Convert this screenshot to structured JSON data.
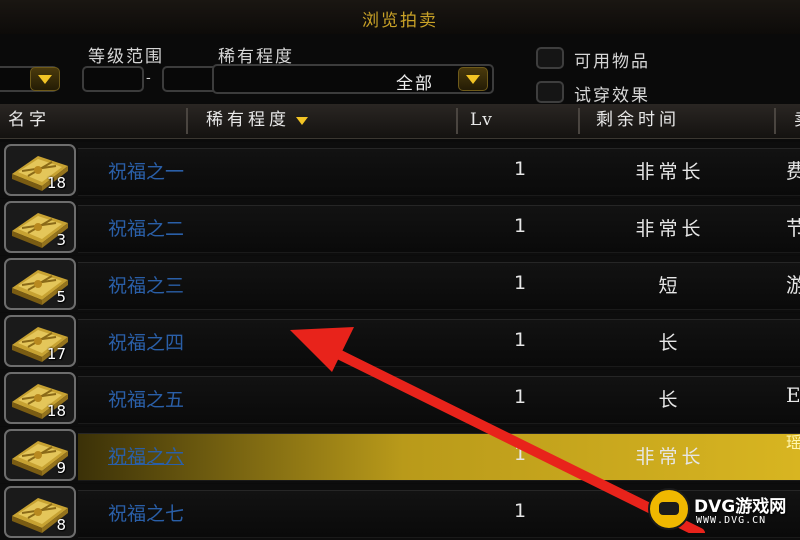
{
  "window": {
    "title": "浏览拍卖"
  },
  "filters": {
    "level_range_label": "等级范围",
    "level_separator": "-",
    "rarity_label": "稀有程度",
    "rarity_value": "全部",
    "usable_items_label": "可用物品",
    "try_on_label": "试穿效果"
  },
  "columns": {
    "name": "名字",
    "rarity": "稀有程度",
    "lv": "Lv",
    "time_left": "剩余时间",
    "seller": "卖"
  },
  "rows": [
    {
      "name": "祝福之一",
      "count": "18",
      "lv": "1",
      "time_left": "非常长",
      "seller": "费"
    },
    {
      "name": "祝福之二",
      "count": "3",
      "lv": "1",
      "time_left": "非常长",
      "seller": "节"
    },
    {
      "name": "祝福之三",
      "count": "5",
      "lv": "1",
      "time_left": "短",
      "seller": "游"
    },
    {
      "name": "祝福之四",
      "count": "17",
      "lv": "1",
      "time_left": "长",
      "seller": ""
    },
    {
      "name": "祝福之五",
      "count": "18",
      "lv": "1",
      "time_left": "长",
      "seller": "E"
    },
    {
      "name": "祝福之六",
      "count": "9",
      "lv": "1",
      "time_left": "非常长",
      "seller": "瑶",
      "selected": true
    },
    {
      "name": "祝福之七",
      "count": "8",
      "lv": "1",
      "time_left": "非",
      "seller": ""
    }
  ],
  "watermark": {
    "brand": "DVG游戏网",
    "url": "WWW.DVG.CN"
  },
  "colors": {
    "accent_gold": "#f2c425",
    "item_name_blue": "#2a5fa8",
    "annotation_arrow": "#e8231b"
  }
}
